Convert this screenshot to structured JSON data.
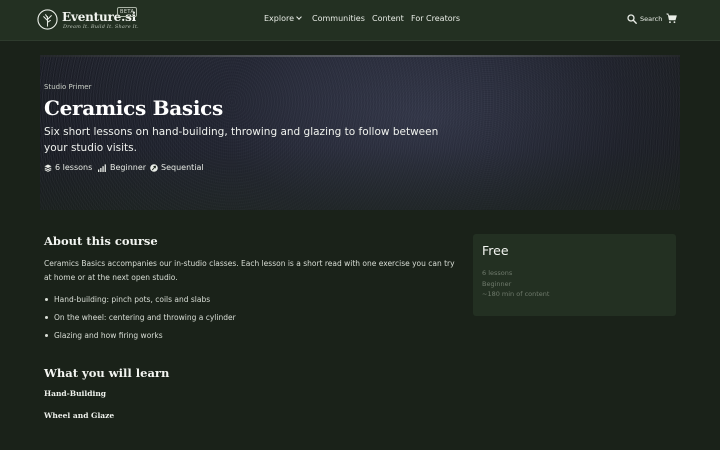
{
  "header": {
    "brand": "Eventure.si",
    "beta_badge": "BETA",
    "tagline": "Dream It. Build It. Share It.",
    "nav": {
      "explore": "Explore",
      "communities": "Communities",
      "content": "Content",
      "for_creators": "For Creators"
    },
    "search_label": "Search",
    "icons": [
      "tree-logo-icon",
      "chevron-down-icon",
      "search-icon",
      "cart-icon"
    ]
  },
  "hero": {
    "eyebrow": "Studio Primer",
    "title": "Ceramics Basics",
    "subtitle": "Six short lessons on hand-building, throwing and glazing to follow between your studio visits.",
    "meta": {
      "lessons": "6 lessons",
      "level": "Beginner",
      "order": "Sequential"
    }
  },
  "about": {
    "heading": "About this course",
    "text": "Ceramics Basics accompanies our in-studio classes. Each lesson is a short read with one exercise you can try at home or at the next open studio.",
    "bullets": [
      "Hand-building: pinch pots, coils and slabs",
      "On the wheel: centering and throwing a cylinder",
      "Glazing and how firing works"
    ]
  },
  "learn": {
    "heading": "What you will learn",
    "items": [
      "Hand-Building",
      "Wheel and Glaze"
    ]
  },
  "card": {
    "price": "Free",
    "lessons": "6 lessons",
    "level": "Beginner",
    "duration": "~180 min of content"
  },
  "colors": {
    "background": "#1a2219",
    "header": "#233022",
    "card": "#233022",
    "muted_text": "#6f7a6c"
  }
}
